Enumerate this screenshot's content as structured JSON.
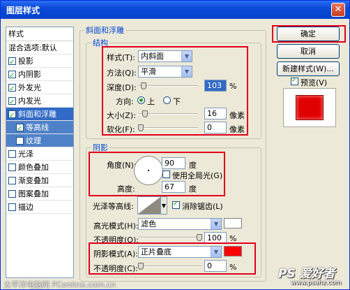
{
  "window": {
    "title": "图层样式",
    "close_glyph": "✕"
  },
  "style_list": {
    "header": "样式",
    "items": [
      {
        "label": "混合选项:默认",
        "checkbox": false,
        "checked": false
      },
      {
        "label": "投影",
        "checkbox": true,
        "checked": true
      },
      {
        "label": "内阴影",
        "checkbox": true,
        "checked": true
      },
      {
        "label": "外发光",
        "checkbox": true,
        "checked": true
      },
      {
        "label": "内发光",
        "checkbox": true,
        "checked": true
      },
      {
        "label": "斜面和浮雕",
        "checkbox": true,
        "checked": true,
        "selected": true
      },
      {
        "label": "等高线",
        "checkbox": true,
        "checked": true,
        "sub": true
      },
      {
        "label": "纹理",
        "checkbox": true,
        "checked": false,
        "sub": true
      },
      {
        "label": "光泽",
        "checkbox": true,
        "checked": false
      },
      {
        "label": "颜色叠加",
        "checkbox": true,
        "checked": false
      },
      {
        "label": "渐变叠加",
        "checkbox": true,
        "checked": false
      },
      {
        "label": "图案叠加",
        "checkbox": true,
        "checked": false
      },
      {
        "label": "描边",
        "checkbox": true,
        "checked": false
      }
    ]
  },
  "bevel": {
    "section_title": "斜面和浮雕",
    "structure": {
      "title": "结构",
      "style_label": "样式(T):",
      "style_value": "内斜面",
      "method_label": "方法(Q):",
      "method_value": "平滑",
      "depth_label": "深度(D):",
      "depth_value": "103",
      "depth_unit": "%",
      "direction_label": "方向:",
      "direction_up": "上",
      "direction_down": "下",
      "size_label": "大小(Z):",
      "size_value": "16",
      "size_unit": "像素",
      "soften_label": "软化(F):",
      "soften_value": "0",
      "soften_unit": "像素"
    },
    "shading": {
      "title": "阴影",
      "angle_label": "角度(N):",
      "angle_value": "90",
      "angle_unit": "度",
      "global_light_label": "使用全局光(G)",
      "altitude_label": "高度:",
      "altitude_value": "67",
      "altitude_unit": "度",
      "gloss_contour_label": "光泽等高线:",
      "antialias_label": "消除锯齿(L)",
      "highlight_mode_label": "高光模式(H):",
      "highlight_mode_value": "滤色",
      "highlight_color": "#ffffff",
      "highlight_opacity_label": "不透明度(O):",
      "highlight_opacity_value": "100",
      "highlight_opacity_unit": "%",
      "shadow_mode_label": "阴影模式(A):",
      "shadow_mode_value": "正片叠底",
      "shadow_color": "#ff0000",
      "shadow_opacity_label": "不透明度(C):",
      "shadow_opacity_value": "0",
      "shadow_opacity_unit": "%"
    }
  },
  "buttons": {
    "ok": "确定",
    "cancel": "取消",
    "new_style": "新建样式(W)...",
    "preview_label": "预览(V)"
  },
  "preview_color": "#e00000",
  "watermark": {
    "left": "太平洋电脑网 PConline.com.cn",
    "right_logo": "PS 爱好者",
    "right_url": "www.psahz.com"
  }
}
